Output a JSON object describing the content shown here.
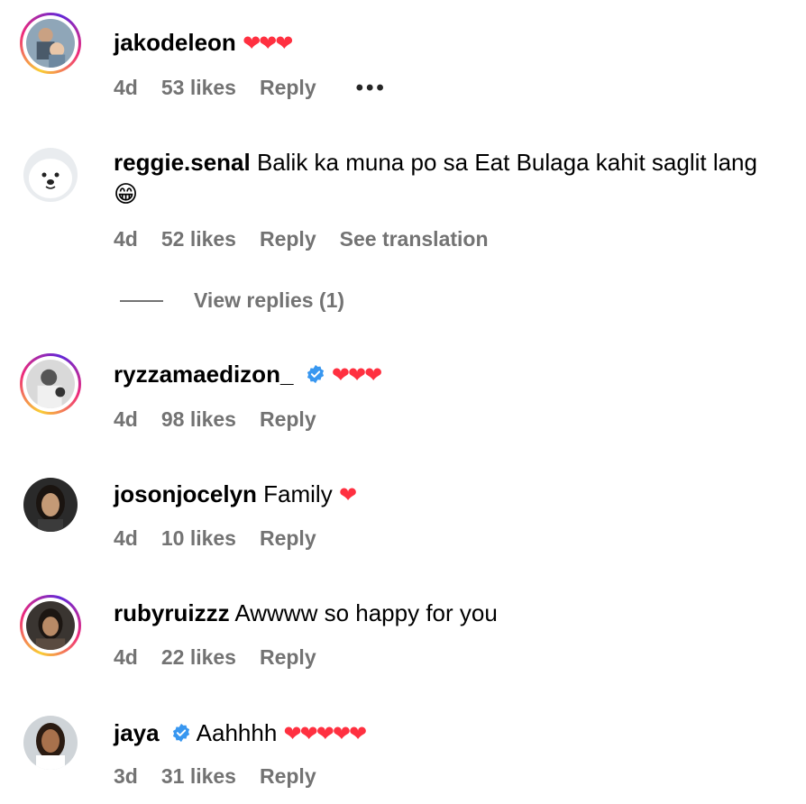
{
  "comments": [
    {
      "user": "jakodeleon",
      "text": "",
      "hearts": "❤❤❤",
      "time": "4d",
      "likes": "53 likes",
      "reply": "Reply",
      "more": "•••"
    },
    {
      "user": "reggie.senal",
      "text": "Balik ka muna po sa Eat Bulaga kahit saglit lang 😁",
      "time": "4d",
      "likes": "52 likes",
      "reply": "Reply",
      "translate": "See translation"
    },
    {
      "user": "ryzzamaedizon_",
      "text": "",
      "hearts": "❤❤❤",
      "time": "4d",
      "likes": "98 likes",
      "reply": "Reply"
    },
    {
      "user": "josonjocelyn",
      "text": "Family",
      "hearts": "❤",
      "time": "4d",
      "likes": "10 likes",
      "reply": "Reply"
    },
    {
      "user": "rubyruizzz",
      "text": "Awwww so happy for you",
      "time": "4d",
      "likes": "22 likes",
      "reply": "Reply"
    },
    {
      "user": "jaya",
      "text": "Aahhhh",
      "hearts": "❤❤❤❤❤",
      "time": "3d",
      "likes": "31 likes",
      "reply": "Reply"
    }
  ],
  "view_replies": "View replies (1)",
  "colors": {
    "verified": "#3897f0",
    "heart": "#ff3040",
    "meta": "#737373"
  }
}
